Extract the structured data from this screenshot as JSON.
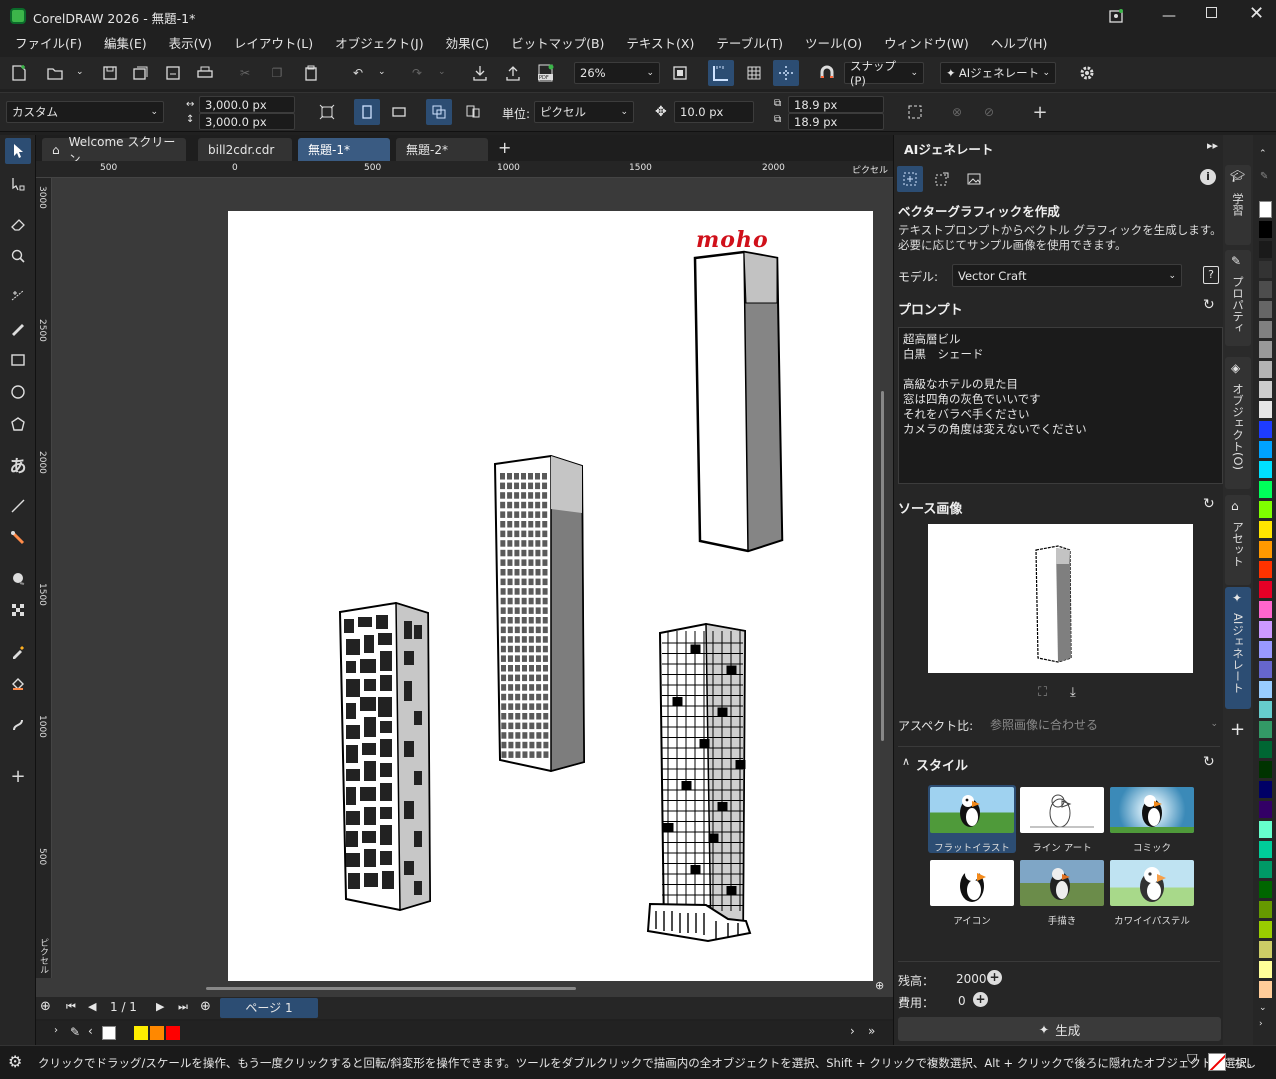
{
  "window": {
    "title": "CorelDRAW 2026 - 無題-1*"
  },
  "menu": [
    "ファイル(F)",
    "編集(E)",
    "表示(V)",
    "レイアウト(L)",
    "オブジェクト(J)",
    "効果(C)",
    "ビットマップ(B)",
    "テキスト(X)",
    "テーブル(T)",
    "ツール(O)",
    "ウィンドウ(W)",
    "ヘルプ(H)"
  ],
  "toolbar": {
    "zoom": "26%",
    "snap_label": "スナップ(P)",
    "ai_label": "AIジェネレート"
  },
  "propbar": {
    "page_preset": "カスタム",
    "width": "3,000.0 px",
    "height": "3,000.0 px",
    "unit_label": "単位:",
    "unit_value": "ピクセル",
    "nudge": "10.0 px",
    "dup_x": "18.9 px",
    "dup_y": "18.9 px"
  },
  "tabs": [
    "Welcome スクリーン",
    "bill2cdr.cdr",
    "無題-1*",
    "無題-2*"
  ],
  "ruler": {
    "h_ticks": [
      "500",
      "0",
      "500",
      "1000",
      "1500",
      "2000"
    ],
    "h_unit": "ピクセル",
    "v_ticks": [
      "3000",
      "2500",
      "2000",
      "1500",
      "1000",
      "500"
    ],
    "v_unit": "ピクセル"
  },
  "canvas": {
    "logo_text": "moho"
  },
  "pagenav": {
    "counter": "1 / 1",
    "page_tab": "ページ 1"
  },
  "panel": {
    "title": "AIジェネレート",
    "heading": "ベクターグラフィックを作成",
    "description": "テキストプロンプトからベクトル グラフィックを生成します。必要に応じてサンプル画像を使用できます。",
    "model_label": "モデル:",
    "model_value": "Vector Craft",
    "prompt_label": "プロンプト",
    "prompt_lines": [
      "超高層ビル",
      "白黒　シェード",
      "",
      "高級なホテルの見た目",
      "窓は四角の灰色でいいです",
      "それをバラベ手ください",
      "カメラの角度は変えないでください"
    ],
    "source_label": "ソース画像",
    "aspect_label": "アスペクト比:",
    "aspect_value": "参照画像に合わせる",
    "style_label": "スタイル",
    "styles": [
      "フラットイラスト",
      "ライン アート",
      "コミック",
      "アイコン",
      "手描き",
      "カワイイパステル"
    ],
    "balance_label": "残高：",
    "balance_value": "2000",
    "cost_label": "費用：",
    "cost_value": "0",
    "generate_label": "生成"
  },
  "dockers": [
    "学習",
    "プロパティ",
    "オブジェクト(O)",
    "アセット",
    "AIジェネレート"
  ],
  "status": {
    "message": "クリックでドラッグ/スケールを操作、もう一度クリックすると回転/斜変形を操作できます。ツールをダブルクリックで描画内の全オブジェクトを選択、Shift + クリックで複数選択、Alt + クリックで後ろに隠れたオブジェクトを選択。",
    "fill_none": "なし"
  },
  "colors": {
    "accent": "#2c4d73",
    "logo": "#d0101a",
    "palette": [
      "#ffffff",
      "#000000",
      "#1a1a1a",
      "#333333",
      "#4d4d4d",
      "#666666",
      "#808080",
      "#999999",
      "#b3b3b3",
      "#cccccc",
      "#e6e6e6",
      "#1e3cff",
      "#00a2ff",
      "#00e0ff",
      "#00ff5a",
      "#7fff00",
      "#ffe600",
      "#ff9900",
      "#ff3300",
      "#e60026",
      "#ff66cc",
      "#cc99ff",
      "#9999ff",
      "#6666cc",
      "#99ccff",
      "#66cccc",
      "#339966",
      "#006633",
      "#003300",
      "#000066",
      "#330066",
      "#66ffcc",
      "#00cc99",
      "#009966",
      "#006600",
      "#669900",
      "#99cc00",
      "#cccc66",
      "#ffff99",
      "#ffcc99"
    ]
  }
}
